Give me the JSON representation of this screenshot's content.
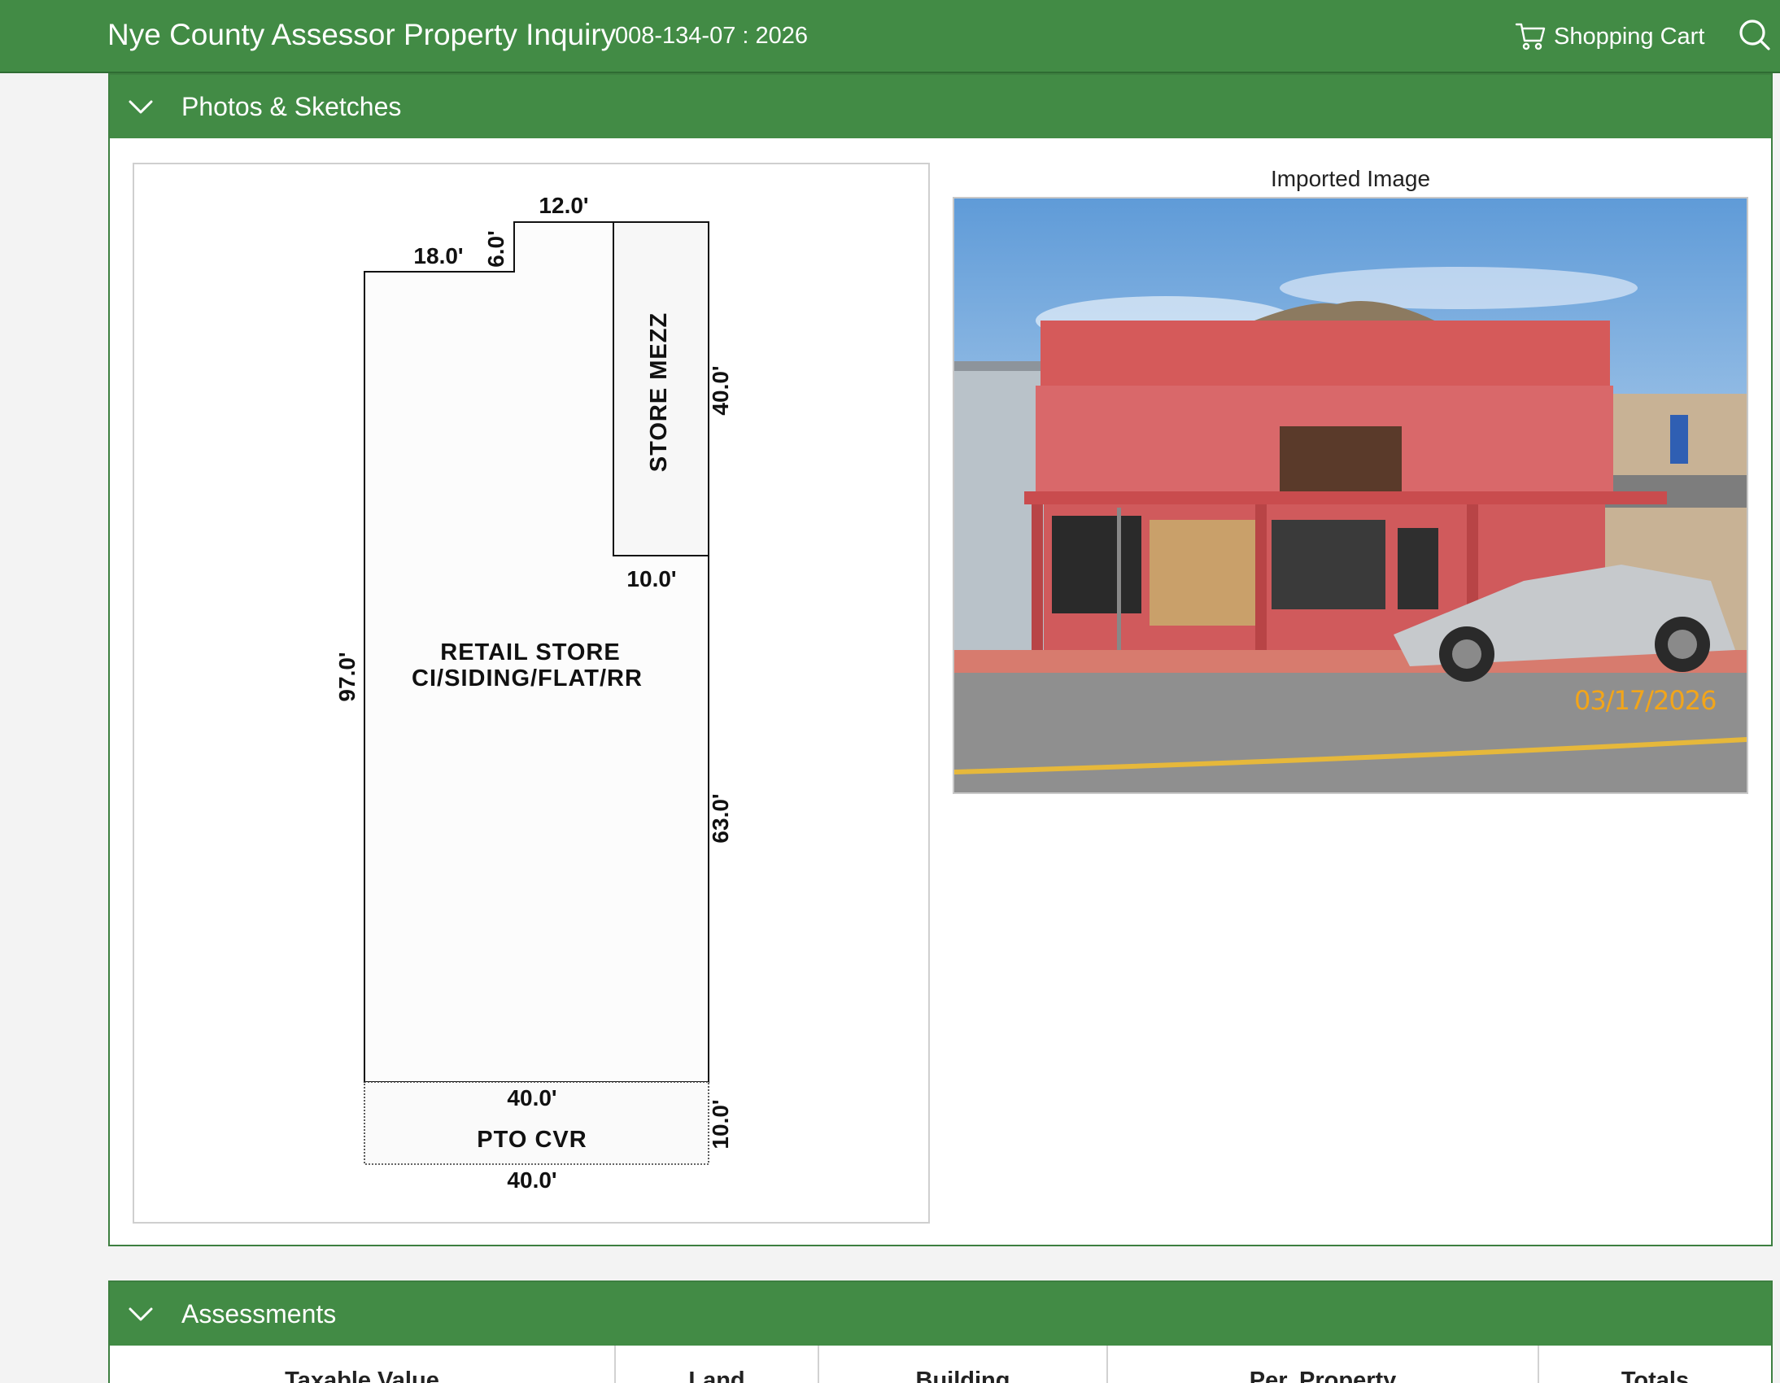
{
  "header": {
    "title": "Nye County Assessor Property Inquiry",
    "parcel": "008-134-07 : 2026",
    "cart_label": "Shopping Cart",
    "cart_icon": "shopping-cart-icon",
    "search_icon": "search-icon"
  },
  "photos_panel": {
    "title": "Photos & Sketches",
    "toggle_icon": "chevron-down-icon",
    "sketch": {
      "dimensions": {
        "top_step_width": "12.0'",
        "upper_left_width": "18.0'",
        "step_height": "6.0'",
        "mezz_height": "40.0'",
        "mezz_width": "10.0'",
        "left_height": "97.0'",
        "right_lower_height": "63.0'",
        "store_bottom_width": "40.0'",
        "patio_height": "10.0'",
        "patio_bottom_width": "40.0'"
      },
      "rooms": {
        "mezz": "STORE MEZZ",
        "retail_line1": "RETAIL STORE",
        "retail_line2": "CI/SIDING/FLAT/RR",
        "patio": "PTO CVR"
      }
    },
    "image_caption": "Imported Image",
    "photo_date": "03/17/2026"
  },
  "assessments_panel": {
    "title": "Assessments",
    "columns": [
      "Taxable Value",
      "Land",
      "Building",
      "Per. Property",
      "Totals"
    ]
  },
  "colors": {
    "brand_green": "#428b45",
    "date_stamp": "#f2a51a"
  }
}
